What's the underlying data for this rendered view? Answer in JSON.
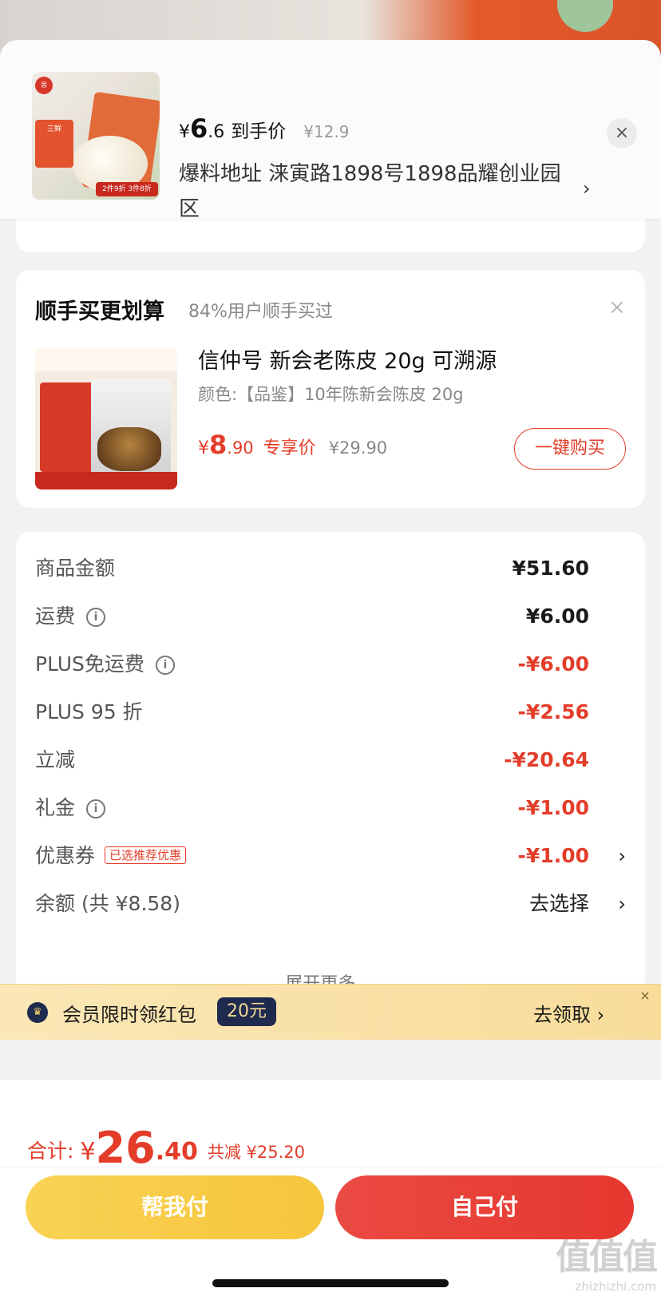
{
  "header": {
    "price_currency": "¥",
    "price_int": "6",
    "price_dec": ".6",
    "price_label": "到手价",
    "original_price": "¥12.9",
    "address": "爆料地址  涞寅路1898号1898品耀创业园区",
    "chevron": "›",
    "close": "×"
  },
  "recommend": {
    "title": "顺手买更划算",
    "subtitle": "84%用户顺手买过",
    "close": "×",
    "product_name": "信仲号 新会老陈皮 20g 可溯源",
    "product_color": "颜色:【品鉴】10年陈新会陈皮 20g",
    "price_currency": "¥",
    "price_int": "8",
    "price_dec": ".90",
    "price_label": "专享价",
    "original_price": "¥29.90",
    "buy_button": "一键购买"
  },
  "summary": {
    "rows": [
      {
        "label": "商品金额",
        "value": "¥51.60"
      },
      {
        "label": "运费",
        "value": "¥6.00"
      },
      {
        "label": "PLUS免运费",
        "value": "-¥6.00"
      },
      {
        "label": "PLUS 95 折",
        "value": "-¥2.56"
      },
      {
        "label": "立减",
        "value": "-¥20.64"
      },
      {
        "label": "礼金",
        "value": "-¥1.00"
      },
      {
        "label": "优惠券",
        "badge": "已选推荐优惠",
        "value": "-¥1.00"
      },
      {
        "label": "余额 (共 ¥8.58)",
        "value": "去选择"
      }
    ],
    "info_glyph": "i",
    "chevron": "›",
    "expand": "展开更多 ⌄"
  },
  "banner": {
    "icon": "♛",
    "text": "会员限时领红包",
    "amount": "20元",
    "action": "去领取 ›",
    "close": "×"
  },
  "footer": {
    "total_label": "合计:",
    "total_currency": "¥",
    "total_int": "26",
    "total_dec": ".40",
    "saved": "共减 ¥25.20",
    "help_pay": "帮我付",
    "self_pay": "自己付"
  },
  "watermark": {
    "logo": "值值值",
    "site": "zhizhizhi.com"
  },
  "colors": {
    "accent_red": "#e33d2a",
    "yellow_button": "#f6c53c",
    "member_navy": "#1e2a4e"
  }
}
